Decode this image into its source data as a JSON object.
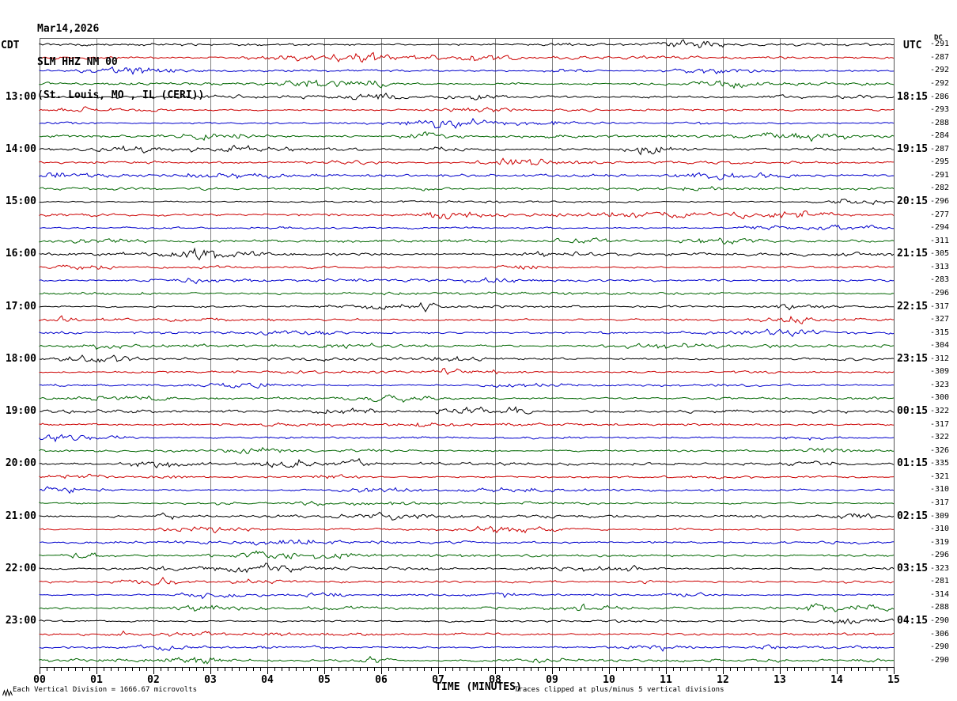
{
  "title": {
    "line1": "Mar14,2026",
    "line2": "SLM HHZ NM 00",
    "line3": "(St. Louis, MO , IL (CERI))"
  },
  "axes": {
    "left_tz": "CDT",
    "right_tz": "UTC",
    "dc_header": "DC",
    "x_title": "TIME (MINUTES)",
    "x_ticks": [
      "00",
      "01",
      "02",
      "03",
      "04",
      "05",
      "06",
      "07",
      "08",
      "09",
      "10",
      "11",
      "12",
      "13",
      "14",
      "15"
    ]
  },
  "footer": {
    "scale_note": "Each Vertical Division = 1666.67 microvolts",
    "clip_note": "Traces clipped at plus/minus 5 vertical divisions"
  },
  "colors": {
    "trace_cycle": [
      "#000000",
      "#cc0000",
      "#0000cc",
      "#006600"
    ],
    "grid": "#808080",
    "axis": "#000000",
    "background": "#ffffff"
  },
  "chart_data": {
    "type": "line",
    "title": "Helicorder seismogram SLM HHZ NM 00 (St. Louis, MO , IL (CERI)), Mar14,2026",
    "x_label": "TIME (MINUTES)",
    "x_range_minutes": [
      0,
      15
    ],
    "rows_count": 48,
    "row_duration_minutes": 15,
    "trace_color_cycle": [
      "black",
      "red",
      "blue",
      "green"
    ],
    "clip_note": "Traces clipped at plus/minus 5 vertical divisions",
    "scale_note": "Each Vertical Division = 1666.67 microvolts",
    "rows": [
      {
        "cdt": "",
        "utc": "",
        "dc": -291,
        "color": "black"
      },
      {
        "cdt": "",
        "utc": "",
        "dc": -287,
        "color": "red"
      },
      {
        "cdt": "",
        "utc": "",
        "dc": -292,
        "color": "blue"
      },
      {
        "cdt": "",
        "utc": "",
        "dc": -292,
        "color": "green"
      },
      {
        "cdt": "13:00",
        "utc": "18:15",
        "dc": -286,
        "color": "black"
      },
      {
        "cdt": "",
        "utc": "",
        "dc": -293,
        "color": "red"
      },
      {
        "cdt": "",
        "utc": "",
        "dc": -288,
        "color": "blue"
      },
      {
        "cdt": "",
        "utc": "",
        "dc": -284,
        "color": "green"
      },
      {
        "cdt": "14:00",
        "utc": "19:15",
        "dc": -287,
        "color": "black"
      },
      {
        "cdt": "",
        "utc": "",
        "dc": -295,
        "color": "red"
      },
      {
        "cdt": "",
        "utc": "",
        "dc": -291,
        "color": "blue"
      },
      {
        "cdt": "",
        "utc": "",
        "dc": -282,
        "color": "green"
      },
      {
        "cdt": "15:00",
        "utc": "20:15",
        "dc": -296,
        "color": "black"
      },
      {
        "cdt": "",
        "utc": "",
        "dc": -277,
        "color": "red"
      },
      {
        "cdt": "",
        "utc": "",
        "dc": -294,
        "color": "blue"
      },
      {
        "cdt": "",
        "utc": "",
        "dc": -311,
        "color": "green"
      },
      {
        "cdt": "16:00",
        "utc": "21:15",
        "dc": -305,
        "color": "black"
      },
      {
        "cdt": "",
        "utc": "",
        "dc": -313,
        "color": "red"
      },
      {
        "cdt": "",
        "utc": "",
        "dc": -283,
        "color": "blue"
      },
      {
        "cdt": "",
        "utc": "",
        "dc": -296,
        "color": "green"
      },
      {
        "cdt": "17:00",
        "utc": "22:15",
        "dc": -317,
        "color": "black"
      },
      {
        "cdt": "",
        "utc": "",
        "dc": -327,
        "color": "red"
      },
      {
        "cdt": "",
        "utc": "",
        "dc": -315,
        "color": "blue"
      },
      {
        "cdt": "",
        "utc": "",
        "dc": -304,
        "color": "green"
      },
      {
        "cdt": "18:00",
        "utc": "23:15",
        "dc": -312,
        "color": "black"
      },
      {
        "cdt": "",
        "utc": "",
        "dc": -309,
        "color": "red"
      },
      {
        "cdt": "",
        "utc": "",
        "dc": -323,
        "color": "blue"
      },
      {
        "cdt": "",
        "utc": "",
        "dc": -300,
        "color": "green"
      },
      {
        "cdt": "19:00",
        "utc": "00:15",
        "dc": -322,
        "color": "black"
      },
      {
        "cdt": "",
        "utc": "",
        "dc": -317,
        "color": "red"
      },
      {
        "cdt": "",
        "utc": "",
        "dc": -322,
        "color": "blue"
      },
      {
        "cdt": "",
        "utc": "",
        "dc": -326,
        "color": "green"
      },
      {
        "cdt": "20:00",
        "utc": "01:15",
        "dc": -335,
        "color": "black"
      },
      {
        "cdt": "",
        "utc": "",
        "dc": -321,
        "color": "red"
      },
      {
        "cdt": "",
        "utc": "",
        "dc": -310,
        "color": "blue"
      },
      {
        "cdt": "",
        "utc": "",
        "dc": -317,
        "color": "green"
      },
      {
        "cdt": "21:00",
        "utc": "02:15",
        "dc": -309,
        "color": "black"
      },
      {
        "cdt": "",
        "utc": "",
        "dc": -310,
        "color": "red"
      },
      {
        "cdt": "",
        "utc": "",
        "dc": -319,
        "color": "blue"
      },
      {
        "cdt": "",
        "utc": "",
        "dc": -296,
        "color": "green"
      },
      {
        "cdt": "22:00",
        "utc": "03:15",
        "dc": -323,
        "color": "black"
      },
      {
        "cdt": "",
        "utc": "",
        "dc": -281,
        "color": "red"
      },
      {
        "cdt": "",
        "utc": "",
        "dc": -314,
        "color": "blue"
      },
      {
        "cdt": "",
        "utc": "",
        "dc": -288,
        "color": "green"
      },
      {
        "cdt": "23:00",
        "utc": "04:15",
        "dc": -290,
        "color": "black"
      },
      {
        "cdt": "",
        "utc": "",
        "dc": -306,
        "color": "red"
      },
      {
        "cdt": "",
        "utc": "",
        "dc": -290,
        "color": "blue"
      },
      {
        "cdt": "",
        "utc": "",
        "dc": -290,
        "color": "green"
      }
    ]
  }
}
